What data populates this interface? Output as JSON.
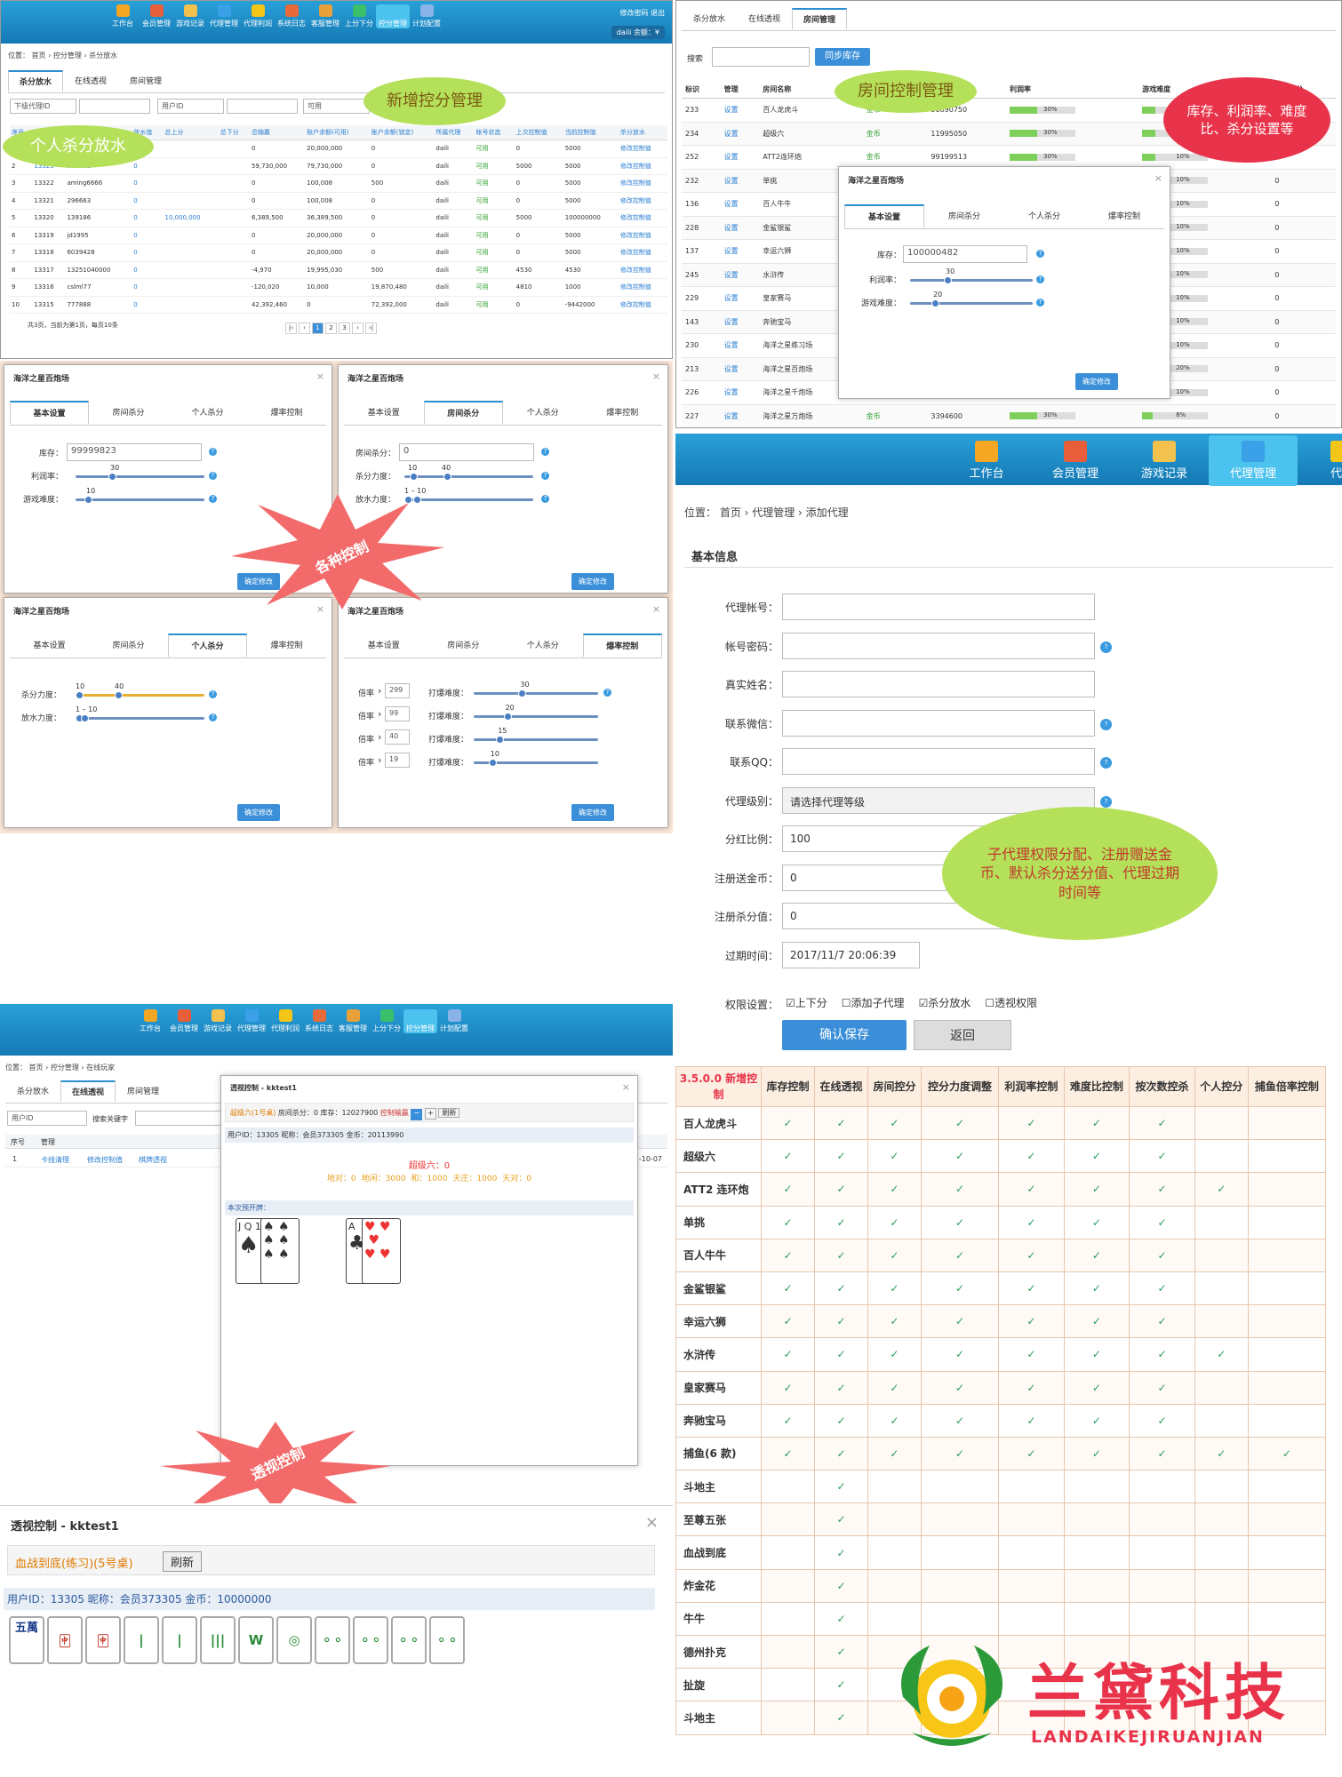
{
  "p1": {
    "topright": "修改密码  退出",
    "user": "daili 余额：¥",
    "nav": [
      "工作台",
      "会员管理",
      "游戏记录",
      "代理管理",
      "代理利润",
      "系统日志",
      "客服管理",
      "上分下分",
      "控分管理",
      "计划配置"
    ],
    "crumb": "位置： 首页 › 控分管理 › 杀分放水",
    "tabs": [
      "杀分放水",
      "在线透视",
      "房间管理"
    ],
    "filters": [
      "下级代理ID",
      "用户ID",
      "可用"
    ],
    "headers": [
      "序号",
      "玩家ID",
      "玩家帐号",
      "放水值",
      "总上分",
      "总下分",
      "总输赢",
      "账户余额(可用)",
      "账户余额(锁定)",
      "所属代理",
      "帐号状态",
      "上次控制值",
      "当前控制值",
      "杀分放水"
    ],
    "rows": [
      [
        "1",
        "13324",
        "yjyh",
        "0",
        "",
        "",
        "0",
        "20,000,000",
        "0",
        "daili",
        "可用",
        "0",
        "5000",
        "修改控制值"
      ],
      [
        "2",
        "13323",
        "000111",
        "0",
        "",
        "",
        "59,730,000",
        "79,730,000",
        "0",
        "daili",
        "可用",
        "5000",
        "5000",
        "修改控制值"
      ],
      [
        "3",
        "13322",
        "aming6666",
        "0",
        "",
        "",
        "0",
        "100,008",
        "500",
        "daili",
        "可用",
        "0",
        "5000",
        "修改控制值"
      ],
      [
        "4",
        "13321",
        "296663",
        "0",
        "",
        "",
        "0",
        "100,008",
        "0",
        "daili",
        "可用",
        "0",
        "5000",
        "修改控制值"
      ],
      [
        "5",
        "13320",
        "139186",
        "0",
        "10,000,000",
        "",
        "6,389,500",
        "36,389,500",
        "0",
        "daili",
        "可用",
        "5000",
        "100000000",
        "修改控制值"
      ],
      [
        "6",
        "13319",
        "jd1995",
        "0",
        "",
        "",
        "0",
        "20,000,000",
        "0",
        "daili",
        "可用",
        "0",
        "5000",
        "修改控制值"
      ],
      [
        "7",
        "13318",
        "6039428",
        "0",
        "",
        "",
        "0",
        "20,000,000",
        "0",
        "daili",
        "可用",
        "0",
        "5000",
        "修改控制值"
      ],
      [
        "8",
        "13317",
        "13251040000",
        "0",
        "",
        "",
        "-4,970",
        "19,995,030",
        "500",
        "daili",
        "可用",
        "4530",
        "4530",
        "修改控制值"
      ],
      [
        "9",
        "13316",
        "cslml77",
        "0",
        "",
        "",
        "-120,020",
        "10,000",
        "19,870,480",
        "daili",
        "可用",
        "4810",
        "1000",
        "修改控制值"
      ],
      [
        "10",
        "13315",
        "777888",
        "0",
        "",
        "",
        "42,392,460",
        "0",
        "72,392,000",
        "daili",
        "可用",
        "0",
        "-9442000",
        "修改控制值"
      ]
    ],
    "footer": "共3页，当前为第1页，每页10条",
    "pager": [
      "|‹",
      "‹",
      "1",
      "2",
      "3",
      "›",
      "›|"
    ],
    "bubble_left": "个人杀分放水",
    "bubble_right": "新增控分管理"
  },
  "p2": {
    "tabs": [
      "杀分放水",
      "在线透视",
      "房间管理"
    ],
    "search_label": "搜索",
    "sync": "同步库存",
    "headers": [
      "标识",
      "管理",
      "房间名称",
      "库存类型",
      "库存",
      "利润率",
      "游戏难度",
      "房间杀分"
    ],
    "rows": [
      [
        "233",
        "设置",
        "百人龙虎斗",
        "金币",
        "90890750",
        "30%",
        "10%",
        "0"
      ],
      [
        "234",
        "设置",
        "超级六",
        "金币",
        "11995050",
        "30%",
        "10%",
        "0"
      ],
      [
        "252",
        "设置",
        "ATT2连环炮",
        "金币",
        "99199513",
        "30%",
        "10%",
        "0"
      ],
      [
        "232",
        "设置",
        "单挑",
        "",
        "",
        "",
        "10%",
        "0"
      ],
      [
        "136",
        "设置",
        "百人牛牛",
        "",
        "",
        "",
        "10%",
        "0"
      ],
      [
        "228",
        "设置",
        "金鲨银鲨",
        "",
        "",
        "",
        "10%",
        "0"
      ],
      [
        "137",
        "设置",
        "幸运六狮",
        "",
        "",
        "",
        "10%",
        "0"
      ],
      [
        "245",
        "设置",
        "水浒传",
        "",
        "",
        "",
        "10%",
        "0"
      ],
      [
        "229",
        "设置",
        "皇家赛马",
        "",
        "",
        "",
        "10%",
        "0"
      ],
      [
        "143",
        "设置",
        "奔驰宝马",
        "",
        "",
        "",
        "10%",
        "0"
      ],
      [
        "230",
        "设置",
        "海洋之星练习场",
        "",
        "",
        "",
        "10%",
        "0"
      ],
      [
        "213",
        "设置",
        "海洋之星百炮场",
        "",
        "",
        "",
        "20%",
        "0"
      ],
      [
        "226",
        "设置",
        "海洋之星千炮场",
        "",
        "",
        "",
        "10%",
        "0"
      ],
      [
        "227",
        "设置",
        "海洋之星万炮场",
        "金币",
        "3394600",
        "30%",
        "8%",
        "0"
      ]
    ],
    "bubble_room": "房间控制管理",
    "bubble_stock": "库存、利润率、难度比、杀分设置等",
    "dialog": {
      "title": "海洋之星百炮场",
      "tabs": [
        "基本设置",
        "房间杀分",
        "个人杀分",
        "爆率控制"
      ],
      "stock_label": "库存：",
      "stock": "100000482",
      "profit_label": "利润率：",
      "profit": "30",
      "diff_label": "游戏难度：",
      "diff": "20",
      "ok": "确定修改"
    }
  },
  "p3": {
    "title": "海洋之星百炮场",
    "tabs": [
      "基本设置",
      "房间杀分",
      "个人杀分",
      "爆率控制"
    ],
    "ok": "确定修改",
    "a": {
      "stock_label": "库存：",
      "stock": "99999823",
      "profit_label": "利润率：",
      "profit": "30",
      "diff_label": "游戏难度：",
      "diff": "10"
    },
    "b": {
      "room_label": "房间杀分：",
      "room": "0",
      "kill_label": "杀分力度：",
      "k1": "10",
      "k2": "40",
      "water_label": "放水力度：",
      "w": "1 – 10"
    },
    "c": {
      "kill_label": "杀分力度：",
      "k1": "10",
      "k2": "40",
      "water_label": "放水力度：",
      "w": "1 – 10"
    },
    "d": {
      "mult_label": "倍率",
      "hit_label": "打爆难度：",
      "rows": [
        [
          "299",
          "30"
        ],
        [
          "99",
          "20"
        ],
        [
          "40",
          "15"
        ],
        [
          "19",
          "10"
        ]
      ]
    },
    "star": "各种控制"
  },
  "p4": {
    "nav": [
      "工作台",
      "会员管理",
      "游戏记录",
      "代理管理",
      "代理"
    ],
    "crumb": "位置： 首页 › 代理管理 › 添加代理",
    "section": "基本信息",
    "fields": [
      {
        "label": "代理帐号：",
        "value": ""
      },
      {
        "label": "帐号密码：",
        "value": ""
      },
      {
        "label": "真实姓名：",
        "value": ""
      },
      {
        "label": "联系微信：",
        "value": ""
      },
      {
        "label": "联系QQ：",
        "value": ""
      },
      {
        "label": "代理级别：",
        "value": "请选择代理等级"
      },
      {
        "label": "分红比例：",
        "value": "100"
      },
      {
        "label": "注册送金币：",
        "value": "0"
      },
      {
        "label": "注册杀分值：",
        "value": "0"
      },
      {
        "label": "过期时间：",
        "value": "2017/11/7 20:06:39"
      }
    ],
    "perm_label": "权限设置：",
    "perms": [
      "上下分",
      "添加子代理",
      "杀分放水",
      "透视权限"
    ],
    "save": "确认保存",
    "back": "返回",
    "bubble": "子代理权限分配、注册赠送金币、默认杀分送分值、代理过期时间等"
  },
  "p5": {
    "nav": [
      "工作台",
      "会员管理",
      "游戏记录",
      "代理管理",
      "代理利润",
      "系统日志",
      "客服管理",
      "上分下分",
      "控分管理",
      "计划配置"
    ],
    "crumb": "位置： 首页 › 控分管理 › 在线玩家",
    "tabs": [
      "杀分放水",
      "在线透视",
      "房间管理"
    ],
    "filter": "用户ID",
    "keyword": "搜索关键字",
    "headers": [
      "序号",
      "管理"
    ],
    "row": [
      "1",
      "卡线清理",
      "修改控制值",
      "棋牌透视"
    ],
    "date": "-10-07",
    "dialog": {
      "title": "透视控制 - kktest1",
      "game": "超级六(1号桌)",
      "room_kill": "房间杀分：0",
      "stock": "库存：12027900",
      "card_ctrl": "控制输赢",
      "refresh": "刷新",
      "info": "用户ID：13305  昵称：会员373305  金币：20113990",
      "result_title": "超级六：0",
      "result": [
        "地对：0",
        "地闲：3000",
        "和：1000",
        "天庄：1000",
        "天对：0"
      ],
      "cards_title": "本次预开牌："
    },
    "star": "透视控制"
  },
  "p6": {
    "title": "透视控制 - kktest1",
    "game": "血战到底(练习)(5号桌)",
    "refresh": "刷新",
    "info": "用户ID：13305  昵称：会员373305  金币：10000000",
    "tiles": [
      "五萬",
      "",
      "",
      "",
      "",
      "",
      "",
      "",
      "",
      "",
      "",
      ""
    ]
  },
  "matrix": {
    "corner": "3.5.0.0 新增控制",
    "headers": [
      "库存控制",
      "在线透视",
      "房间控分",
      "控分力度调整",
      "利润率控制",
      "难度比控制",
      "按次数控杀",
      "个人控分",
      "捕鱼倍率控制"
    ],
    "rows": [
      {
        "name": "百人龙虎斗",
        "c": [
          1,
          1,
          1,
          1,
          1,
          1,
          1,
          0,
          0
        ]
      },
      {
        "name": "超级六",
        "c": [
          1,
          1,
          1,
          1,
          1,
          1,
          1,
          0,
          0
        ]
      },
      {
        "name": "ATT2 连环炮",
        "c": [
          1,
          1,
          1,
          1,
          1,
          1,
          1,
          1,
          0
        ]
      },
      {
        "name": "单挑",
        "c": [
          1,
          1,
          1,
          1,
          1,
          1,
          1,
          0,
          0
        ]
      },
      {
        "name": "百人牛牛",
        "c": [
          1,
          1,
          1,
          1,
          1,
          1,
          1,
          0,
          0
        ]
      },
      {
        "name": "金鲨银鲨",
        "c": [
          1,
          1,
          1,
          1,
          1,
          1,
          1,
          0,
          0
        ]
      },
      {
        "name": "幸运六狮",
        "c": [
          1,
          1,
          1,
          1,
          1,
          1,
          1,
          0,
          0
        ]
      },
      {
        "name": "水浒传",
        "c": [
          1,
          1,
          1,
          1,
          1,
          1,
          1,
          1,
          0
        ]
      },
      {
        "name": "皇家赛马",
        "c": [
          1,
          1,
          1,
          1,
          1,
          1,
          1,
          0,
          0
        ]
      },
      {
        "name": "奔驰宝马",
        "c": [
          1,
          1,
          1,
          1,
          1,
          1,
          1,
          0,
          0
        ]
      },
      {
        "name": "捕鱼(6 款)",
        "c": [
          1,
          1,
          1,
          1,
          1,
          1,
          1,
          1,
          1
        ]
      },
      {
        "name": "斗地主",
        "c": [
          0,
          1,
          0,
          0,
          0,
          0,
          0,
          0,
          0
        ]
      },
      {
        "name": "至尊五张",
        "c": [
          0,
          1,
          0,
          0,
          0,
          0,
          0,
          0,
          0
        ]
      },
      {
        "name": "血战到底",
        "c": [
          0,
          1,
          0,
          0,
          0,
          0,
          0,
          0,
          0
        ]
      },
      {
        "name": "炸金花",
        "c": [
          0,
          1,
          0,
          0,
          0,
          0,
          0,
          0,
          0
        ]
      },
      {
        "name": "牛牛",
        "c": [
          0,
          1,
          0,
          0,
          0,
          0,
          0,
          0,
          0
        ]
      },
      {
        "name": "德州扑克",
        "c": [
          0,
          1,
          0,
          0,
          0,
          0,
          0,
          0,
          0
        ]
      },
      {
        "name": "扯旋",
        "c": [
          0,
          1,
          0,
          0,
          0,
          0,
          0,
          0,
          0
        ]
      },
      {
        "name": "斗地主",
        "c": [
          0,
          1,
          0,
          0,
          0,
          0,
          0,
          0,
          0
        ]
      }
    ],
    "check": "✓"
  },
  "logo": {
    "cn": "兰黛科技",
    "en": "LANDAIKEJIRUANJIAN"
  },
  "colors": {
    "blue": "#1b8bd0",
    "green": "#2a9d5a",
    "red": "#e8334a",
    "bubble_green": "#b5e05a"
  }
}
